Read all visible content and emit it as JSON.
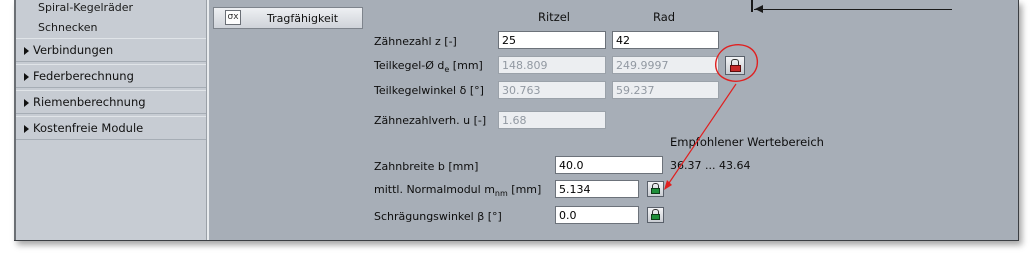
{
  "sidebar": {
    "subitems": [
      "Spiral-Kegelräder",
      "Schnecken"
    ],
    "items": [
      {
        "label": "Verbindungen"
      },
      {
        "label": "Federberechnung"
      },
      {
        "label": "Riemenberechnung"
      },
      {
        "label": "Kostenfreie Module"
      }
    ]
  },
  "toolbar": {
    "tab_label": "Tragfähigkeit",
    "tab_icon": "sigma-x-icon"
  },
  "columns": {
    "ritzel": "Ritzel",
    "rad": "Rad"
  },
  "fields": {
    "zaehnezahl": {
      "label": "Zähnezahl z [-]",
      "ritzel": "25",
      "rad": "42"
    },
    "teilkegel_d": {
      "label_main": "Teilkegel-Ø d",
      "label_sub": "e",
      "label_unit": " [mm]",
      "ritzel": "148.809",
      "rad": "249.9997"
    },
    "teilkegelwinkel": {
      "label": "Teilkegelwinkel δ [°]",
      "ritzel": "30.763",
      "rad": "59.237"
    },
    "uebersetzung": {
      "label": "Zähnezahlverh. u [-]",
      "value": "1.68"
    }
  },
  "range_header": "Empfohlener Wertebereich",
  "params": {
    "zahnbreite": {
      "label": "Zahnbreite b [mm]",
      "value": "40.0",
      "range": "36.37 ... 43.64"
    },
    "normalmodul": {
      "label_main": "mittl. Normalmodul m",
      "label_sub": "nm",
      "label_unit": " [mm]",
      "value": "5.134"
    },
    "schraegungswinkel": {
      "label": "Schrägungswinkel β [°]",
      "value": "0.0"
    }
  },
  "colors": {
    "annotation": "#e02020",
    "lock_locked": "#c62828",
    "lock_unlocked": "#1f8f3a"
  }
}
